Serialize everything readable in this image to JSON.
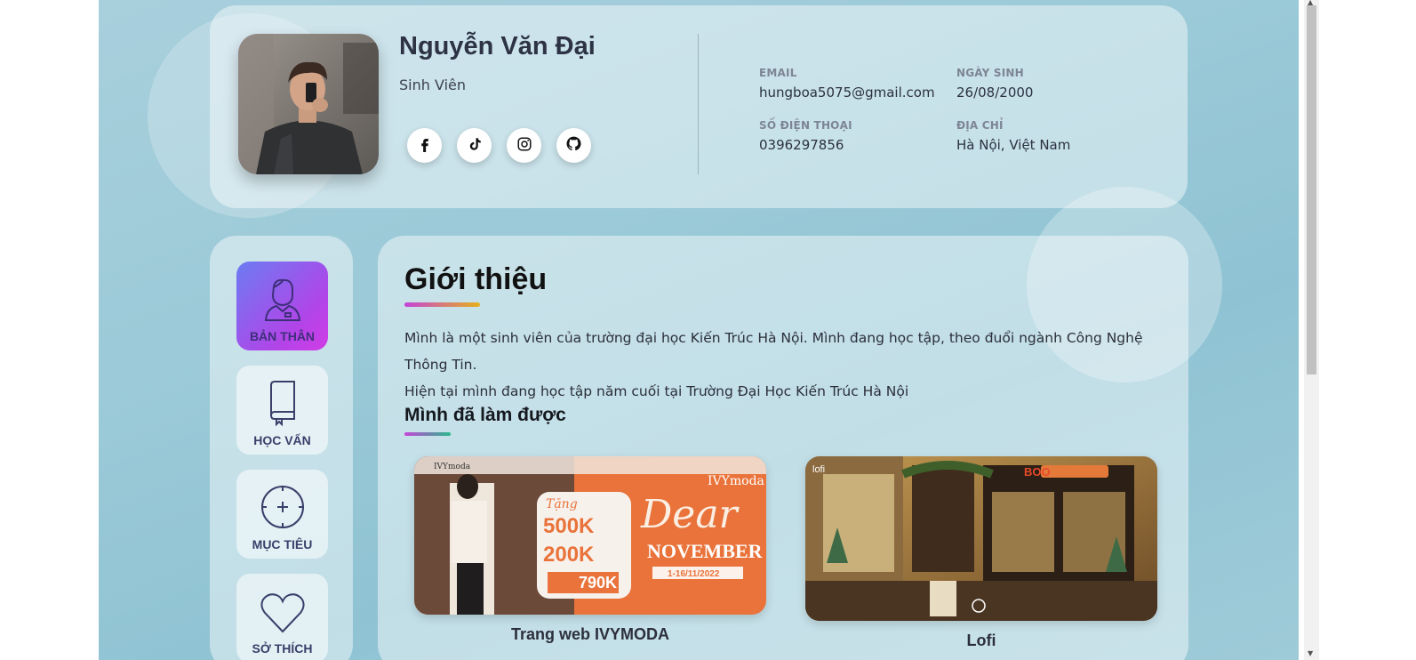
{
  "profile": {
    "name": "Nguyễn Văn Đại",
    "role": "Sinh Viên",
    "socials": [
      "facebook-icon",
      "tiktok-icon",
      "instagram-icon",
      "github-icon"
    ],
    "email_label": "EMAIL",
    "email": "hungboa5075@gmail.com",
    "dob_label": "NGÀY SINH",
    "dob": "26/08/2000",
    "phone_label": "SỐ ĐIỆN THOẠI",
    "phone": "0396297856",
    "address_label": "ĐỊA CHỈ",
    "address": "Hà Nội, Việt Nam"
  },
  "nav": {
    "items": [
      {
        "label": "BẢN THÂN",
        "icon": "person-icon",
        "active": true
      },
      {
        "label": "HỌC VẤN",
        "icon": "book-icon",
        "active": false
      },
      {
        "label": "MỤC TIÊU",
        "icon": "target-icon",
        "active": false
      },
      {
        "label": "SỞ THÍCH",
        "icon": "heart-icon",
        "active": false
      }
    ]
  },
  "content": {
    "title": "Giới thiệu",
    "intro_line1": "Mình là một sinh viên của trường đại học Kiến Trúc Hà Nội. Mình đang học tập, theo đuổi ngành Công Nghệ Thông Tin.",
    "intro_line2": "Hiện tại mình đang học tập năm cuối tại Trường Đại Học Kiến Trúc Hà Nội",
    "subtitle": "Mình đã làm được",
    "projects": [
      {
        "caption": "Trang web IVYMODA",
        "brand": "IVYmoda",
        "promo_top": "Tặng",
        "promo_1": "500K",
        "promo_2": "200K",
        "promo_price": "790K",
        "headline_1": "Dear",
        "headline_2": "NOVEMBER",
        "dates": "1-16/11/2022"
      },
      {
        "caption": "Lofi",
        "corner_label": "lofi",
        "sign": "BOO"
      }
    ]
  },
  "colors": {
    "background": "#9ccad8",
    "active_nav_start": "#6c7cf2",
    "active_nav_end": "#d13de6",
    "ivy_orange": "#e9733a"
  }
}
